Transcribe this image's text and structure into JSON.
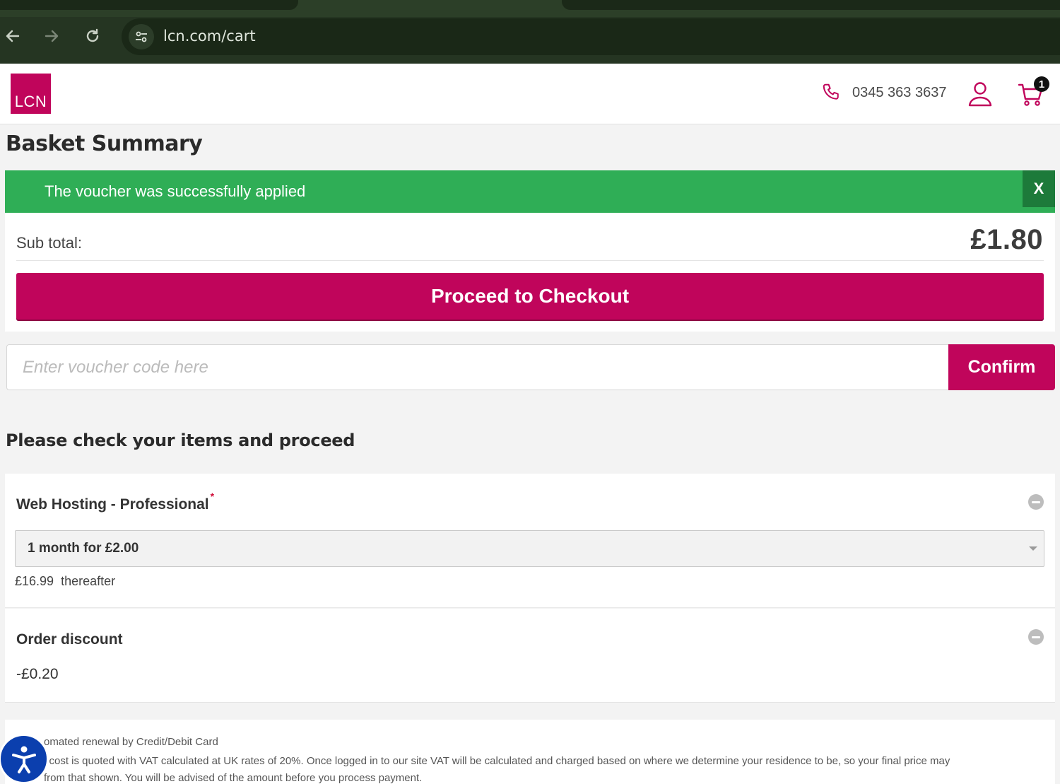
{
  "browser": {
    "url": "lcn.com/cart"
  },
  "header": {
    "logo_text": "LCN",
    "phone": "0345 363 3637",
    "cart_count": "1",
    "brand_color": "#c0055b"
  },
  "page": {
    "title": "Basket Summary"
  },
  "alert": {
    "message": "The voucher was successfully applied",
    "close_label": "X",
    "color": "#2fae56"
  },
  "summary": {
    "subtotal_label": "Sub total:",
    "subtotal_value": "£1.80",
    "checkout_label": "Proceed to Checkout"
  },
  "voucher": {
    "placeholder": "Enter voucher code here",
    "value": "",
    "confirm_label": "Confirm"
  },
  "items_section": {
    "heading": "Please check your items and proceed",
    "items": [
      {
        "name": "Web Hosting - Professional",
        "required_mark": "*",
        "selected_term": "1 month for £2.00",
        "renewal_price": "£16.99",
        "renewal_suffix": "thereafter"
      }
    ],
    "discount": {
      "label": "Order discount",
      "value": "-£0.20"
    }
  },
  "footer": {
    "note_1": "omated renewal by Credit/Debit Card",
    "note_2": "l cost is quoted with VAT calculated at UK rates of 20%. Once logged in to our site VAT will be calculated and charged based on where we determine your residence to be, so your final price may",
    "note_3": "from that shown. You will be advised of the amount before you process payment."
  }
}
